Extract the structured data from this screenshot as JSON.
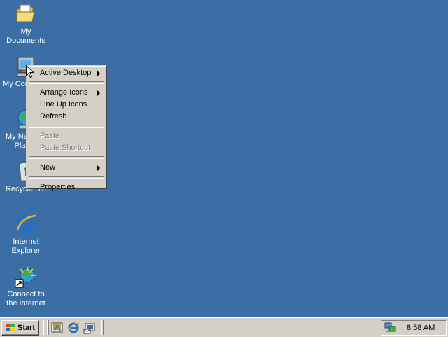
{
  "desktop": {
    "icons": [
      {
        "name": "my-documents",
        "lines": [
          "My Documents"
        ]
      },
      {
        "name": "my-computer",
        "lines": [
          "My Computer"
        ]
      },
      {
        "name": "my-network-places",
        "lines": [
          "My Network",
          "Places"
        ]
      },
      {
        "name": "recycle-bin",
        "lines": [
          "Recycle Bin"
        ]
      },
      {
        "name": "internet-explorer",
        "lines": [
          "Internet",
          "Explorer"
        ]
      },
      {
        "name": "connect-to-internet",
        "lines": [
          "Connect to",
          "the Internet"
        ]
      }
    ]
  },
  "context_menu": {
    "active_desktop": "Active Desktop",
    "arrange_icons": "Arrange Icons",
    "line_up_icons": "Line Up Icons",
    "refresh": "Refresh",
    "paste": "Paste",
    "paste_shortcut": "Paste Shortcut",
    "new": "New",
    "properties": "Properties"
  },
  "taskbar": {
    "start_label": "Start",
    "quick_launch": [
      "show-desktop-icon",
      "internet-explorer-icon",
      "outlook-express-icon"
    ],
    "clock": "8:58 AM",
    "tray_icon": "network-connection-icon"
  },
  "colors": {
    "desktop": "#3A6EA5",
    "face": "#D4D0C8"
  }
}
